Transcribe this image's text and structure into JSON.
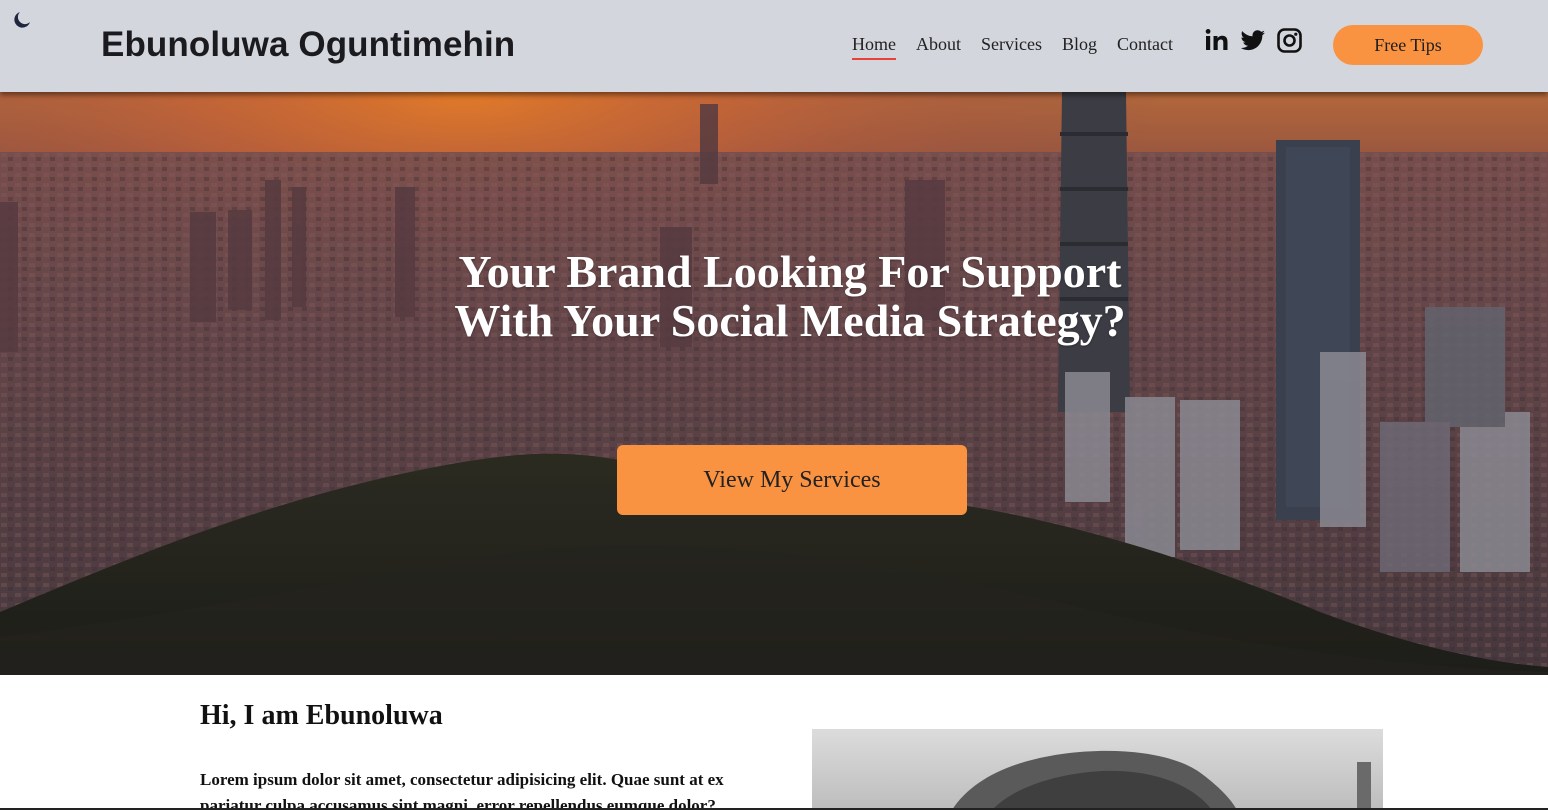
{
  "header": {
    "theme_icon": "moon-icon",
    "brand": "Ebunoluwa Oguntimehin",
    "nav": [
      {
        "label": "Home",
        "active": true
      },
      {
        "label": "About",
        "active": false
      },
      {
        "label": "Services",
        "active": false
      },
      {
        "label": "Blog",
        "active": false
      },
      {
        "label": "Contact",
        "active": false
      }
    ],
    "social_icons": [
      "linkedin-icon",
      "twitter-icon",
      "instagram-icon"
    ],
    "cta_label": "Free Tips"
  },
  "hero": {
    "title": "Your Brand Looking For Support With Your Social Media Strategy?",
    "button_label": "View My Services"
  },
  "about": {
    "heading": "Hi, I am Ebunoluwa",
    "text": "Lorem ipsum dolor sit amet, consectetur adipisicing elit. Quae sunt at ex pariatur culpa accusamus sint magni, error repellendus eumque dolor?"
  },
  "colors": {
    "header_bg": "#d3d6dd",
    "accent": "#fa9341",
    "active_underline": "#e8413a"
  }
}
